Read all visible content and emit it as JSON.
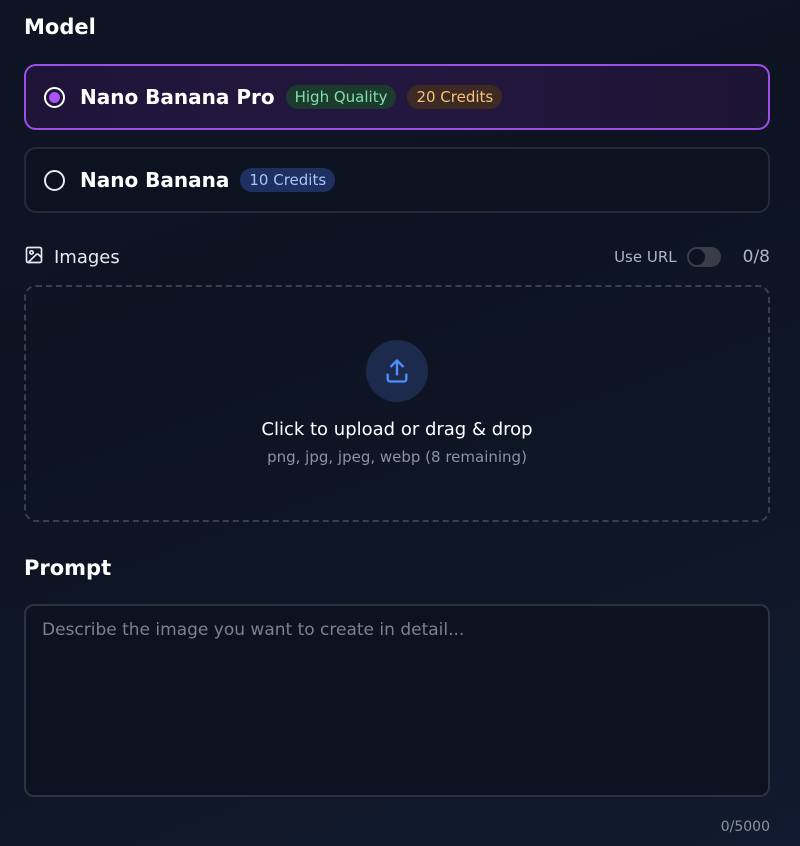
{
  "model_section": {
    "title": "Model",
    "options": [
      {
        "name": "Nano Banana Pro",
        "selected": true,
        "badges": [
          {
            "text": "High Quality",
            "color": "#7fe0a8"
          },
          {
            "text": "20 Credits",
            "color": "#f5c27a"
          }
        ]
      },
      {
        "name": "Nano Banana",
        "selected": false,
        "badges": [
          {
            "text": "10 Credits",
            "color": "#a9c4f5"
          }
        ]
      }
    ]
  },
  "images_section": {
    "icon": "image-icon",
    "label": "Images",
    "use_url_label": "Use URL",
    "use_url_enabled": false,
    "count": "0/8",
    "upload": {
      "icon": "upload-icon",
      "title": "Click to upload or drag & drop",
      "subtitle": "png, jpg, jpeg, webp (8 remaining)"
    }
  },
  "prompt_section": {
    "title": "Prompt",
    "placeholder": "Describe the image you want to create in detail...",
    "value": "",
    "char_count": "0/5000"
  },
  "colors": {
    "accent": "#9d4de8",
    "radio_dot": "#a855f7",
    "background": "#0f1424"
  }
}
